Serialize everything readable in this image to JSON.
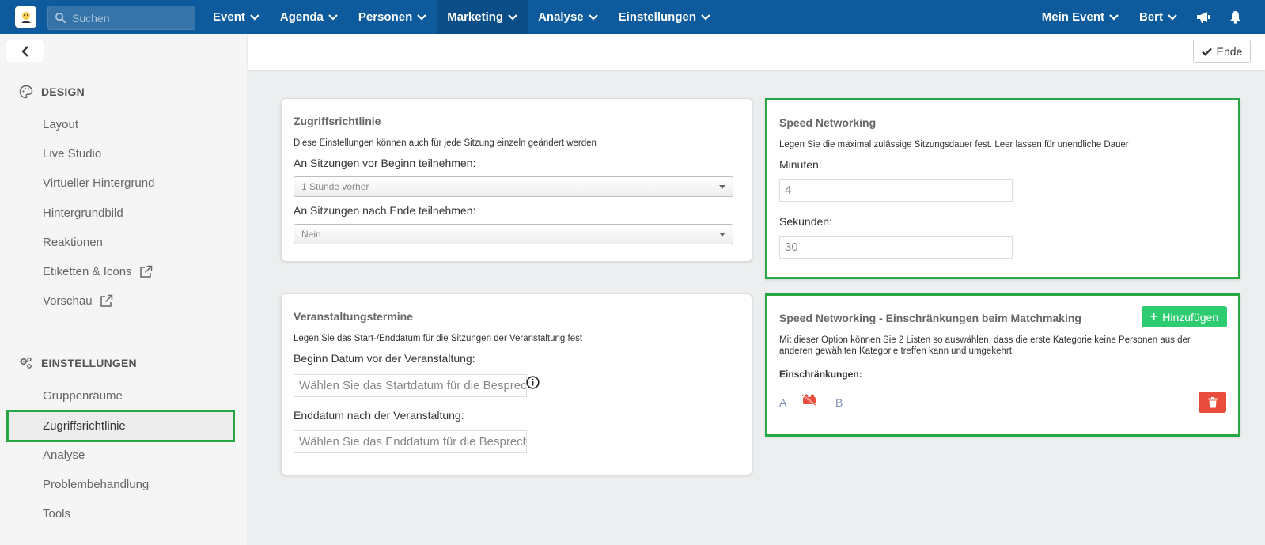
{
  "topbar": {
    "search_placeholder": "Suchen",
    "nav_left": [
      "Event",
      "Agenda",
      "Personen",
      "Marketing",
      "Analyse",
      "Einstellungen"
    ],
    "active_nav": "Marketing",
    "nav_right": [
      "Mein Event",
      "Bert"
    ]
  },
  "sidebar": {
    "design_title": "DESIGN",
    "design_items": [
      "Layout",
      "Live Studio",
      "Virtueller Hintergrund",
      "Hintergrundbild",
      "Reaktionen",
      "Etiketten & Icons",
      "Vorschau"
    ],
    "settings_title": "EINSTELLUNGEN",
    "settings_items": [
      "Gruppenräume",
      "Zugriffsrichtlinie",
      "Analyse",
      "Problembehandlung",
      "Tools"
    ],
    "active_item": "Zugriffsrichtlinie"
  },
  "header": {
    "end_label": "Ende"
  },
  "access_policy": {
    "title": "Zugriffsrichtlinie",
    "desc": "Diese Einstellungen können auch für jede Sitzung einzeln geändert werden",
    "before_label": "An Sitzungen vor Beginn teilnehmen:",
    "before_value": "1 Stunde vorher",
    "after_label": "An Sitzungen nach Ende teilnehmen:",
    "after_value": "Nein"
  },
  "event_dates": {
    "title": "Veranstaltungstermine",
    "desc": "Legen Sie das Start-/Enddatum für die Sitzungen der Veranstaltung fest",
    "start_label": "Beginn Datum vor der Veranstaltung:",
    "start_placeholder": "Wählen Sie das Startdatum für die Besprechung",
    "end_label": "Enddatum nach der Veranstaltung:",
    "end_placeholder": "Wählen Sie das Enddatum für die Besprechung"
  },
  "speed_networking": {
    "title": "Speed Networking",
    "desc": "Legen Sie die maximal zulässige Sitzungsdauer fest. Leer lassen für unendliche Dauer",
    "minutes_label": "Minuten:",
    "minutes_value": "4",
    "seconds_label": "Sekunden:",
    "seconds_value": "30"
  },
  "restrictions": {
    "title": "Speed Networking - Einschränkungen beim Matchmaking",
    "add_label": "Hinzufügen",
    "desc": "Mit dieser Option können Sie 2 Listen so auswählen, dass die erste Kategorie keine Personen aus der anderen gewählten Kategorie treffen kann und umgekehrt.",
    "list_label": "Einschränkungen:",
    "item_a": "A",
    "item_b": "B"
  },
  "colors": {
    "nav_bg": "#0d5a9c",
    "highlight": "#27a844",
    "add_button": "#2ecc71",
    "delete_button": "#e74c3c"
  }
}
